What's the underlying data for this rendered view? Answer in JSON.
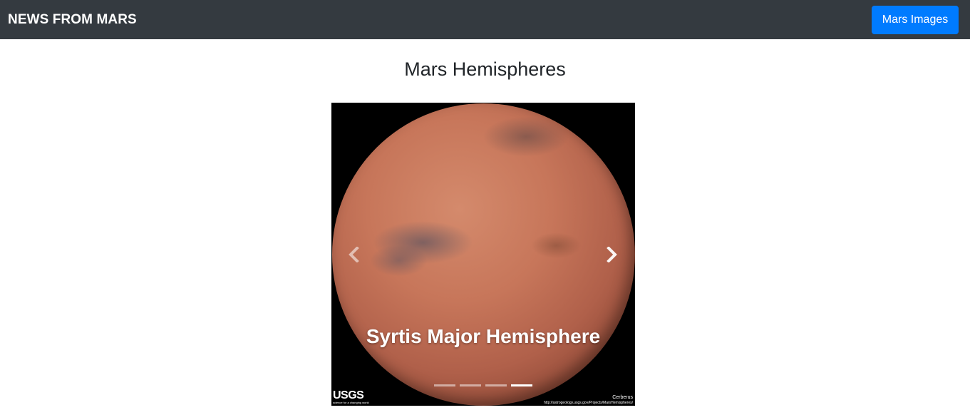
{
  "navbar": {
    "brand": "NEWS FROM MARS",
    "button_label": "Mars Images",
    "background": "#343a40",
    "button_color": "#007bff"
  },
  "main": {
    "title": "Mars Hemispheres"
  },
  "carousel": {
    "caption": "Syrtis Major Hemisphere",
    "prev_icon": "chevron-left-icon",
    "next_icon": "chevron-right-icon",
    "slide_count": 4,
    "active_slide_index": 3,
    "image_text": {
      "logo": "USGS",
      "logo_tagline": "science for a changing world",
      "credit_name": "Cerberus",
      "credit_url": "http://astrogeology.usgs.gov/Projects/MarsHemispheres/"
    }
  }
}
